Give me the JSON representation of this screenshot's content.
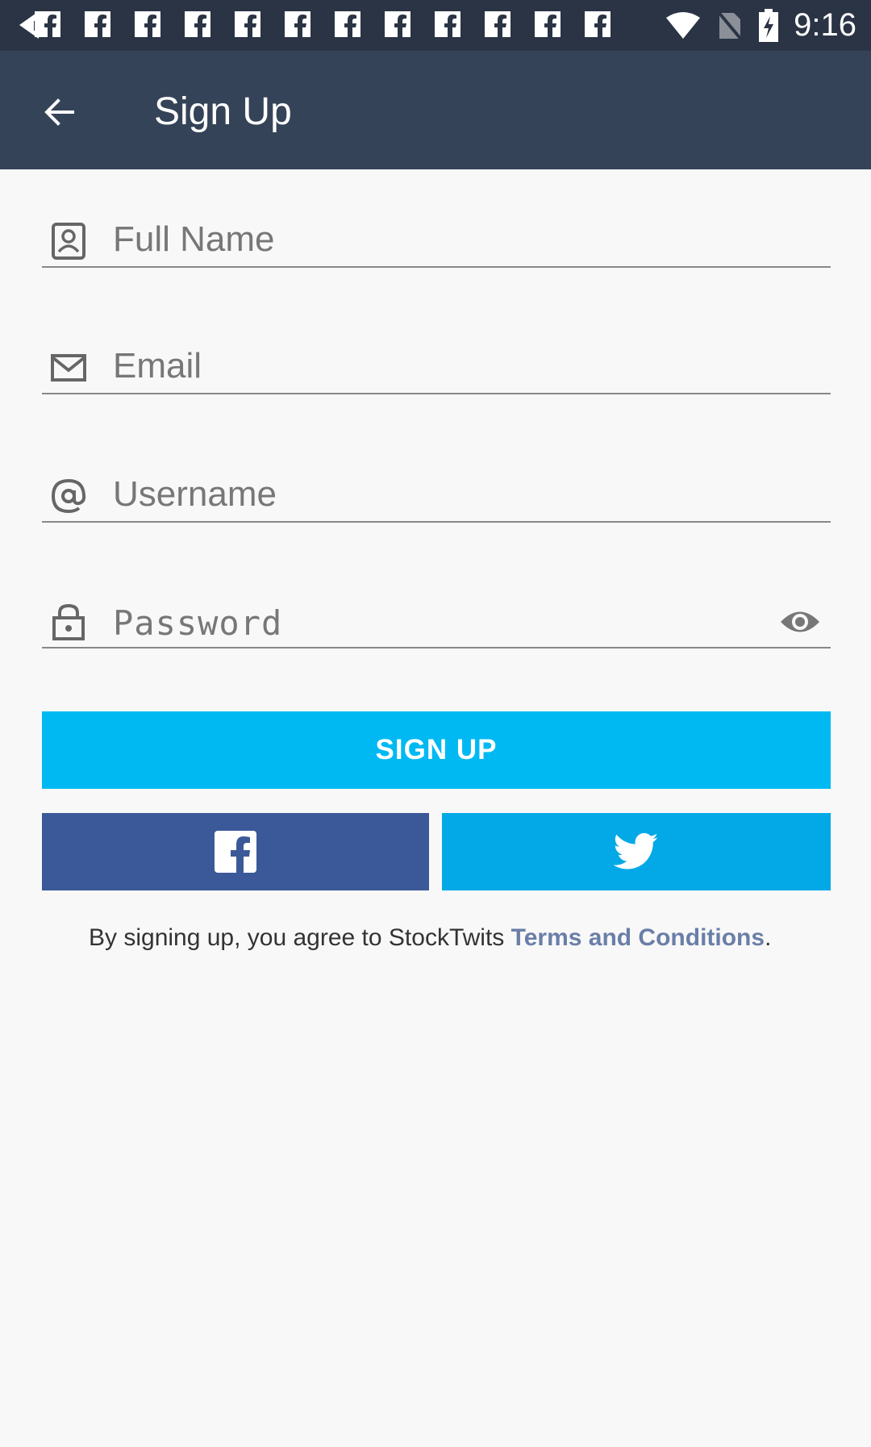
{
  "status_bar": {
    "time": "9:16",
    "notification_icons": [
      "facebook-icon",
      "facebook-icon",
      "facebook-icon",
      "facebook-icon",
      "facebook-icon",
      "facebook-icon",
      "facebook-icon",
      "facebook-icon",
      "facebook-icon",
      "facebook-icon",
      "facebook-icon",
      "facebook-icon"
    ],
    "indicators": [
      "wifi-icon",
      "no-sim-icon",
      "battery-charging-icon"
    ]
  },
  "app_bar": {
    "title": "Sign Up",
    "background": "#354358"
  },
  "form": {
    "full_name": {
      "placeholder": "Full Name",
      "icon": "contact-card-icon"
    },
    "email": {
      "placeholder": "Email",
      "icon": "envelope-icon"
    },
    "username": {
      "placeholder": "Username",
      "icon": "at-sign-icon"
    },
    "password": {
      "placeholder": "Password",
      "icon": "lock-icon",
      "toggle_icon": "eye-icon"
    }
  },
  "buttons": {
    "sign_up": "SIGN UP",
    "sign_up_color": "#00b9f2",
    "facebook_color": "#3b5998",
    "twitter_color": "#03a9e6"
  },
  "terms": {
    "prefix": "By signing up, you agree to StockTwits ",
    "link": "Terms and Conditions",
    "suffix": "."
  }
}
